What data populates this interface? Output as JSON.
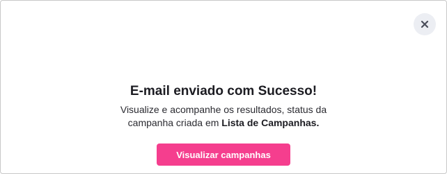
{
  "modal": {
    "title": "E-mail enviado com Sucesso!",
    "description_prefix": "Visualize e acompanhe os resultados, status da campanha criada em",
    "description_link": "Lista de Campanhas.",
    "button_label": "Visualizar campanhas",
    "close_icon": "close-icon",
    "colors": {
      "button_bg": "#f53e8e",
      "close_bg": "#eceef3",
      "title": "#1c1c22"
    }
  }
}
